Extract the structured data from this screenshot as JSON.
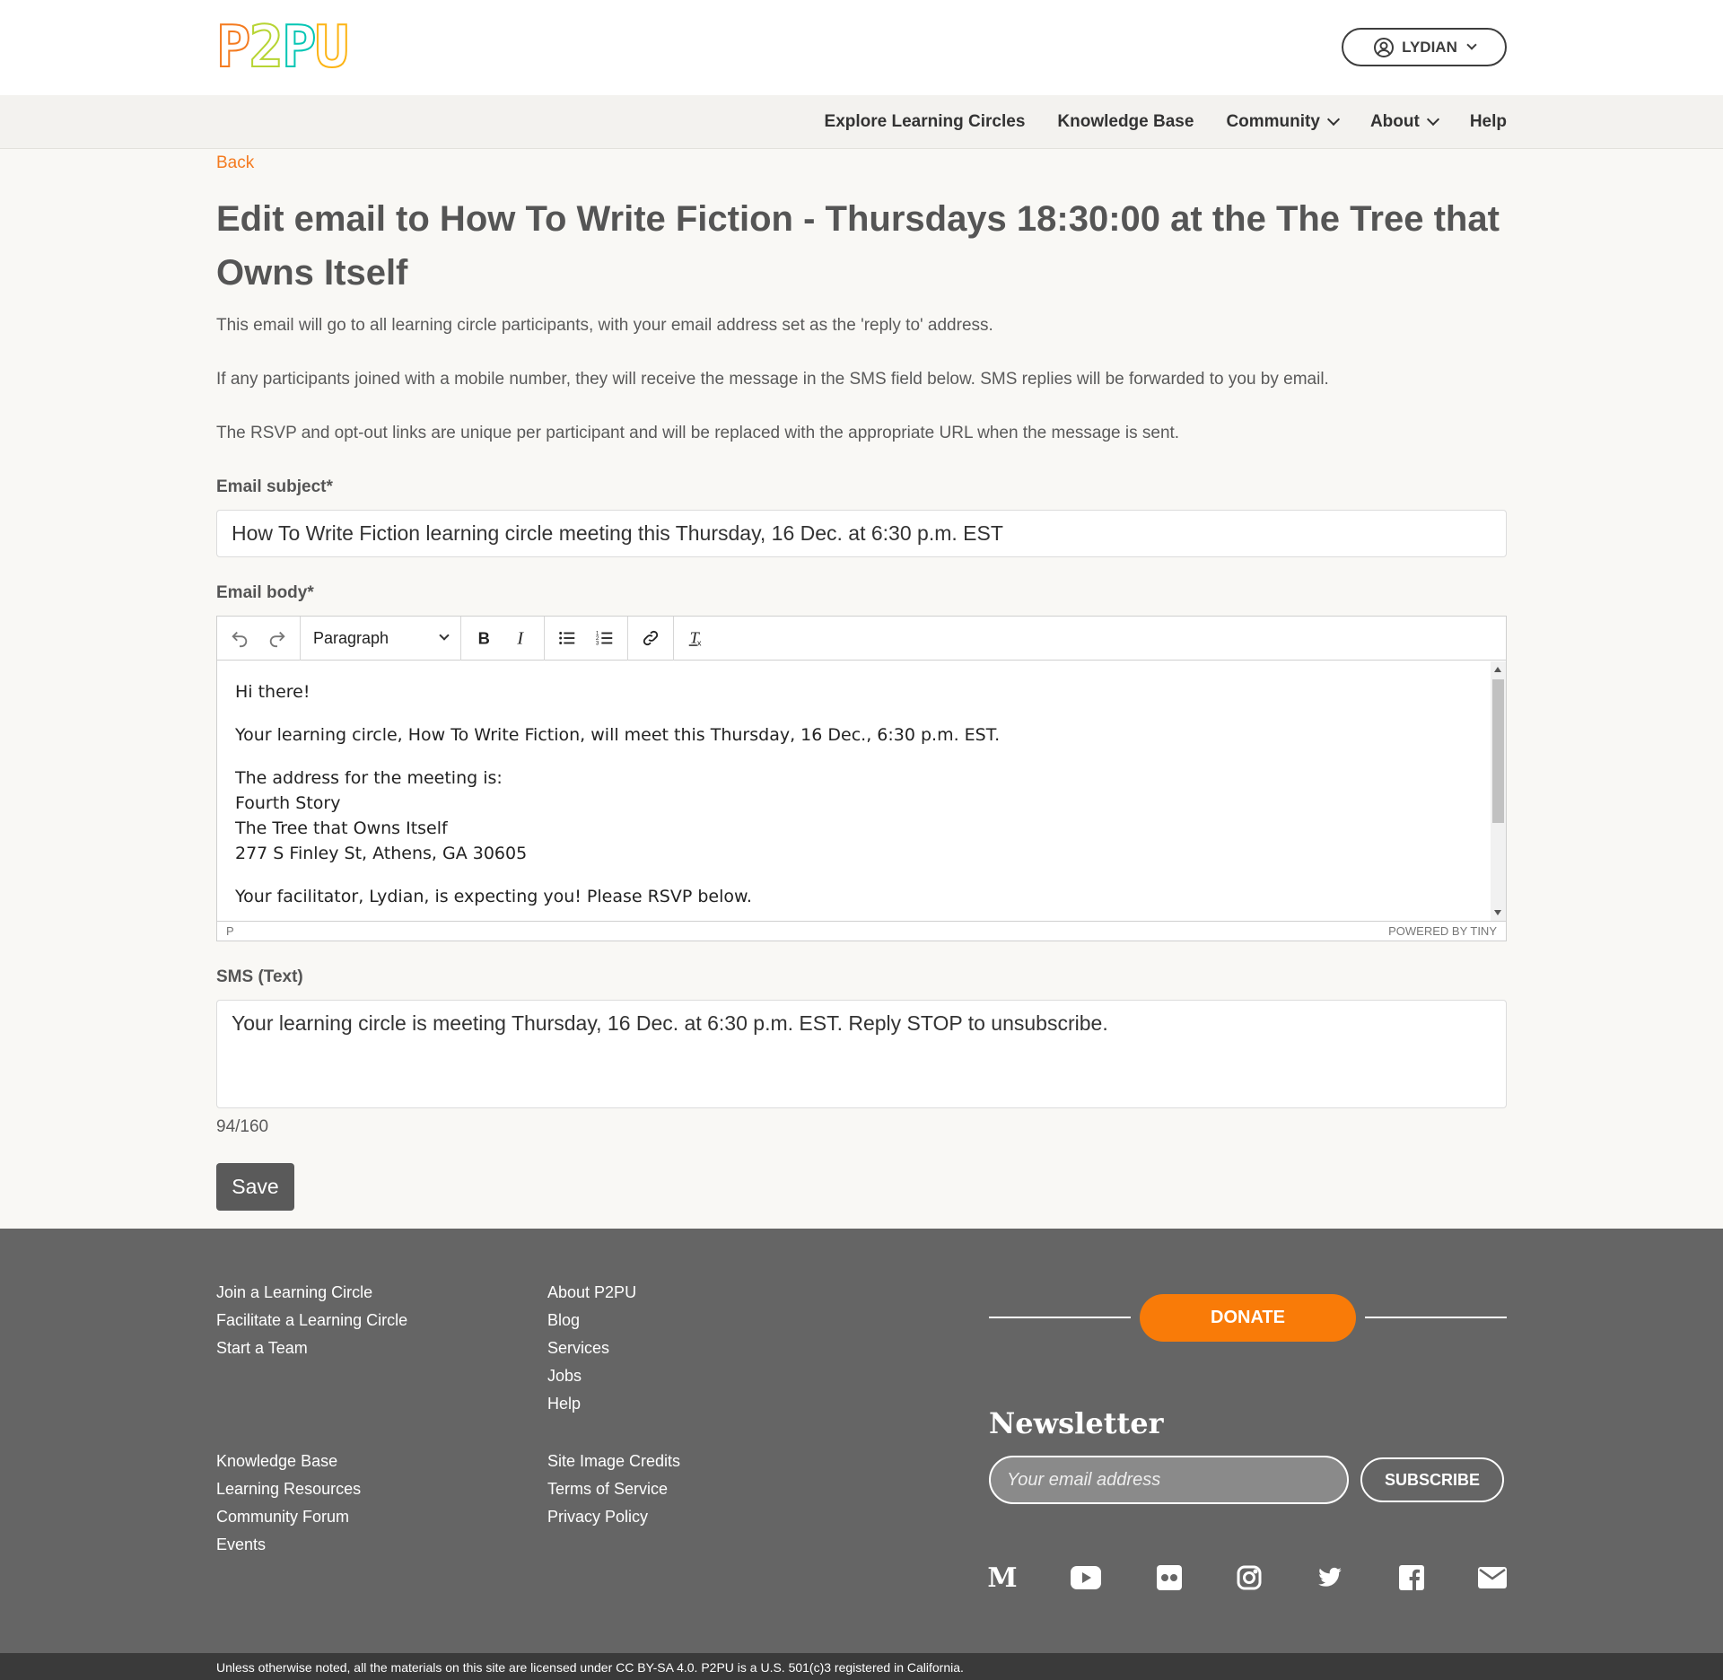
{
  "header": {
    "logo": {
      "letters": [
        "P",
        "2",
        "P",
        "U"
      ]
    },
    "user_button": "LYDIAN",
    "nav": [
      {
        "label": "Explore Learning Circles",
        "dropdown": false
      },
      {
        "label": "Knowledge Base",
        "dropdown": false
      },
      {
        "label": "Community",
        "dropdown": true
      },
      {
        "label": "About",
        "dropdown": true
      },
      {
        "label": "Help",
        "dropdown": false
      }
    ]
  },
  "page": {
    "back": "Back",
    "title": "Edit email to How To Write Fiction - Thursdays 18:30:00 at the The Tree that Owns Itself",
    "intro1": "This email will go to all learning circle participants, with your email address set as the 'reply to' address.",
    "intro2": "If any participants joined with a mobile number, they will receive the message in the SMS field below. SMS replies will be forwarded to you by email.",
    "intro3": "The RSVP and opt-out links are unique per participant and will be replaced with the appropriate URL when the message is sent.",
    "subject_label": "Email subject*",
    "subject_value": "How To Write Fiction learning circle meeting this Thursday, 16 Dec. at 6:30 p.m. EST",
    "body_label": "Email body*",
    "sms_label": "SMS (Text)",
    "sms_value": "Your learning circle is meeting Thursday, 16 Dec. at 6:30 p.m. EST. Reply STOP to unsubscribe.",
    "sms_counter": "94/160",
    "save": "Save"
  },
  "editor": {
    "block_format": "Paragraph",
    "status_path": "P",
    "powered_by": "POWERED BY TINY",
    "body": {
      "line1": "Hi there!",
      "line2": "Your learning circle, How To Write Fiction, will meet this Thursday, 16 Dec., 6:30 p.m. EST.",
      "address_intro": "The address for the meeting is:",
      "address_line1": "Fourth Story",
      "address_line2": "The Tree that Owns Itself",
      "address_line3": "277 S Finley St, Athens, GA 30605",
      "line4": "Your facilitator, Lydian, is expecting you! Please RSVP below."
    }
  },
  "footer": {
    "col1_top": [
      "Join a Learning Circle",
      "Facilitate a Learning Circle",
      "Start a Team"
    ],
    "col2_top": [
      "About P2PU",
      "Blog",
      "Services",
      "Jobs",
      "Help"
    ],
    "col1_bottom": [
      "Knowledge Base",
      "Learning Resources",
      "Community Forum",
      "Events"
    ],
    "col2_bottom": [
      "Site Image Credits",
      "Terms of Service",
      "Privacy Policy"
    ],
    "donate": "DONATE",
    "newsletter_title": "Newsletter",
    "email_placeholder": "Your email address",
    "subscribe": "SUBSCRIBE",
    "social_icons": [
      "medium-icon",
      "youtube-icon",
      "flickr-icon",
      "instagram-icon",
      "twitter-icon",
      "facebook-icon",
      "mail-icon"
    ],
    "medium_glyph": "M",
    "legal": "Unless otherwise noted, all the materials on this site are licensed under CC BY-SA 4.0. P2PU is a U.S. 501(c)3 registered in California."
  },
  "colors": {
    "accent_orange": "#f47b20",
    "donate_orange": "#f97b08",
    "footer_bg": "#656565",
    "save_bg": "#5a5a5a"
  }
}
